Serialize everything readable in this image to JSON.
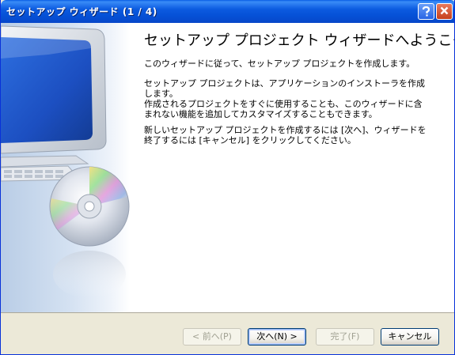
{
  "window": {
    "title": "セットアップ ウィザード (1 / 4)"
  },
  "titlebar": {
    "help_icon": "question-mark-icon",
    "close_icon": "close-x-icon"
  },
  "main": {
    "headline": "セットアップ プロジェクト ウィザードへようこそ",
    "paragraphs": [
      "このウィザードに従って、セットアップ プロジェクトを作成します。",
      "セットアップ プロジェクトは、アプリケーションのインストーラを作成します。",
      "作成されるプロジェクトをすぐに使用することも、このウィザードに含まれない機能を追加してカスタマイズすることもできます。",
      "新しいセットアップ プロジェクトを作成するには [次へ]、ウィザードを終了するには [キャンセル] をクリックしてください。"
    ]
  },
  "buttons": {
    "back": "< 前へ(P)",
    "next": "次へ(N) >",
    "finish": "完了(F)",
    "cancel": "キャンセル"
  },
  "colors": {
    "titlebar": "#0550d6",
    "panel": "#ece9d8",
    "content": "#ffffff"
  }
}
